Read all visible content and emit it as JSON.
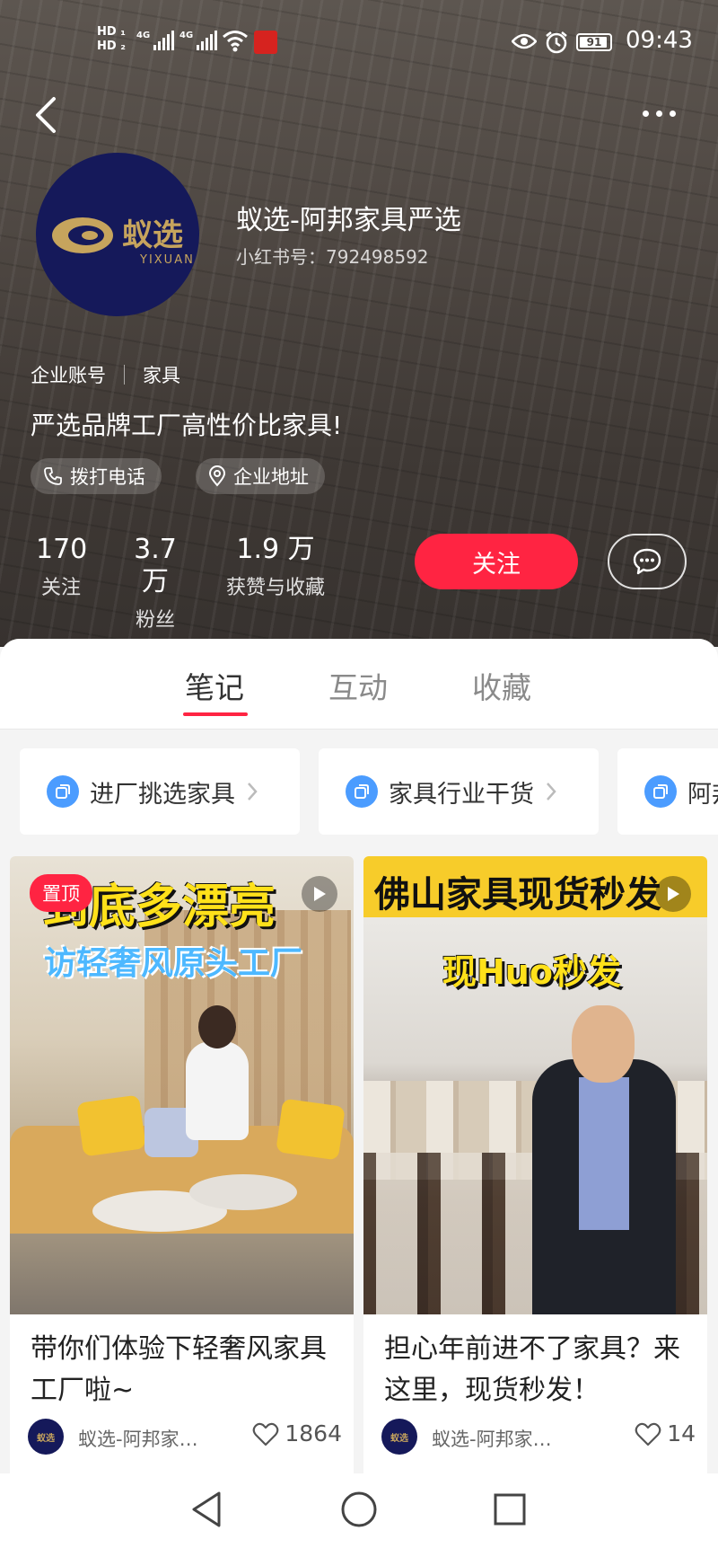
{
  "status_bar": {
    "hd1": "HD",
    "hd2": "HD",
    "net1": "4G",
    "net2": "4G",
    "battery": "91",
    "time": "09:43"
  },
  "profile": {
    "avatar_logo_text": "蚁选",
    "avatar_sub_text": "YIXUAN",
    "name": "蚁选-阿邦家具严选",
    "id_label": "小红书号：792498592",
    "account_type": "企业账号",
    "category": "家具",
    "bio": "严选品牌工厂高性价比家具!",
    "call_label": "拨打电话",
    "address_label": "企业地址",
    "stats": [
      {
        "value": "170",
        "label": "关注"
      },
      {
        "value": "3.7 万",
        "label": "粉丝"
      },
      {
        "value": "1.9 万",
        "label": "获赞与收藏"
      }
    ],
    "follow_label": "关注"
  },
  "tabs": [
    {
      "label": "笔记",
      "active": true
    },
    {
      "label": "互动",
      "active": false
    },
    {
      "label": "收藏",
      "active": false
    }
  ],
  "collections": [
    {
      "label": "进厂挑选家具"
    },
    {
      "label": "家具行业干货"
    },
    {
      "label": "阿邦"
    }
  ],
  "notes": [
    {
      "pinned_label": "置顶",
      "overlay_title": "到底多漂亮",
      "overlay_sub": "访轻奢风原头工厂",
      "title": "带你们体验下轻奢风家具工厂啦~",
      "author": "蚁选-阿邦家…",
      "likes": "1864"
    },
    {
      "overlay_title": "佛山家具现货秒发",
      "overlay_sub": "现Huo秒发",
      "title": "担心年前进不了家具？来这里，现货秒发！",
      "author": "蚁选-阿邦家具…",
      "likes": "14"
    }
  ],
  "colors": {
    "accent": "#ff2442",
    "avatar_bg": "#15195a",
    "avatar_gold": "#c6a45d",
    "collection_icon": "#4b9cff"
  },
  "icons": [
    "back-icon",
    "more-icon",
    "phone-icon",
    "location-icon",
    "chat-icon",
    "collection-icon",
    "play-icon",
    "heart-icon",
    "nav-back-icon",
    "nav-home-icon",
    "nav-recents-icon"
  ]
}
